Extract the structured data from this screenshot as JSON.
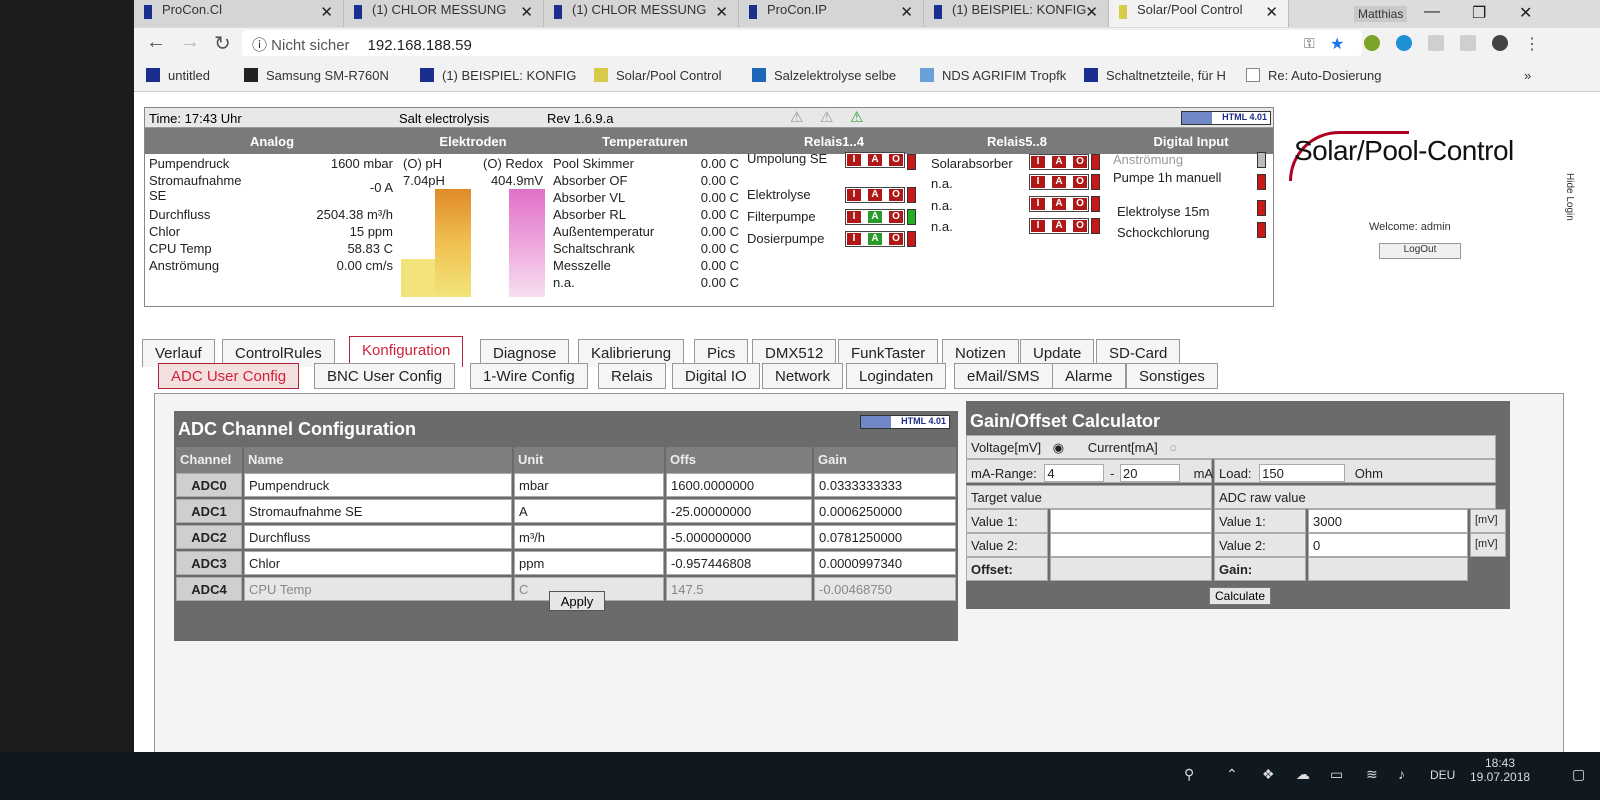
{
  "browser": {
    "tabs": [
      {
        "title": "ProCon.Cl",
        "fav": "blue"
      },
      {
        "title": "(1) CHLOR MESSUNG",
        "fav": "blue"
      },
      {
        "title": "(1) CHLOR MESSUNG",
        "fav": "blue"
      },
      {
        "title": "ProCon.IP",
        "fav": "blue"
      },
      {
        "title": "(1) BEISPIEL: KONFIG",
        "fav": "blue"
      },
      {
        "title": "Solar/Pool Control",
        "fav": "sun"
      }
    ],
    "user": "Matthias",
    "security": "Nicht sicher",
    "url": "192.168.188.59",
    "bookmarks": [
      "untitled",
      "Samsung SM-R760N",
      "(1) BEISPIEL: KONFIG",
      "Solar/Pool Control",
      "Salzelektrolyse selbe",
      "NDS AGRIFIM Tropfk",
      "Schaltnetzteile, für H",
      "Re: Auto-Dosierung"
    ]
  },
  "header": {
    "time": "Time: 17:43 Uhr",
    "mode": "Salt electrolysis",
    "rev": "Rev 1.6.9.a",
    "badge": "HTML 4.01",
    "sections": [
      "Analog",
      "Elektroden",
      "Temperaturen",
      "Relais1..4",
      "Relais5..8",
      "Digital Input"
    ],
    "analog": [
      {
        "label": "Pumpendruck",
        "value": "1600 mbar"
      },
      {
        "label": "Stromaufnahme SE",
        "value": "-0 A"
      },
      {
        "label": "Durchfluss",
        "value": "2504.38 m³/h"
      },
      {
        "label": "Chlor",
        "value": "15 ppm"
      },
      {
        "label": "CPU Temp",
        "value": "58.83 C"
      },
      {
        "label": "Anströmung",
        "value": "0.00 cm/s"
      }
    ],
    "electrodes": {
      "ph_label": "(O) pH",
      "ph_value": "7.04pH",
      "redox_label": "(O) Redox",
      "redox_value": "404.9mV"
    },
    "temps": [
      {
        "label": "Pool Skimmer",
        "value": "0.00 C"
      },
      {
        "label": "Absorber OF",
        "value": "0.00 C"
      },
      {
        "label": "Absorber VL",
        "value": "0.00 C"
      },
      {
        "label": "Absorber RL",
        "value": "0.00 C"
      },
      {
        "label": "Außentemperatur",
        "value": "0.00 C"
      },
      {
        "label": "Schaltschrank",
        "value": "0.00 C"
      },
      {
        "label": "Messzelle",
        "value": "0.00 C"
      },
      {
        "label": "n.a.",
        "value": "0.00 C"
      }
    ],
    "relais1": [
      "Umpolung SE",
      "Elektrolyse",
      "Filterpumpe",
      "Dosierpumpe"
    ],
    "relais2": [
      "Solarabsorber",
      "n.a.",
      "n.a.",
      "n.a."
    ],
    "digital": [
      "Anströmung",
      "Pumpe 1h manuell",
      "Elektrolyse 15m",
      "Schockchlorung"
    ],
    "iao": {
      "i": "I",
      "a": "A",
      "o": "O"
    }
  },
  "brand": {
    "logo": "Solar/Pool-Control",
    "welcome": "Welcome:  admin",
    "logout": "LogOut",
    "hide": "Hide Login"
  },
  "tabs_main": [
    "Verlauf",
    "ControlRules",
    "Konfiguration",
    "Diagnose",
    "Kalibrierung",
    "Pics",
    "DMX512",
    "FunkTaster",
    "Notizen",
    "Update",
    "SD-Card"
  ],
  "tabs_sub": [
    "ADC User Config",
    "BNC User Config",
    "1-Wire Config",
    "Relais",
    "Digital IO",
    "Network",
    "Logindaten",
    "eMail/SMS",
    "Alarme",
    "Sonstiges"
  ],
  "adc": {
    "title": "ADC Channel Configuration",
    "cols": [
      "Channel",
      "Name",
      "Unit",
      "Offs",
      "Gain"
    ],
    "rows": [
      {
        "ch": "ADC0",
        "name": "Pumpendruck",
        "unit": "mbar",
        "offs": "1600.0000000",
        "gain": "0.0333333333"
      },
      {
        "ch": "ADC1",
        "name": "Stromaufnahme SE",
        "unit": "A",
        "offs": "-25.00000000",
        "gain": "0.0006250000"
      },
      {
        "ch": "ADC2",
        "name": "Durchfluss",
        "unit": "m³/h",
        "offs": "-5.000000000",
        "gain": "0.0781250000"
      },
      {
        "ch": "ADC3",
        "name": "Chlor",
        "unit": "ppm",
        "offs": "-0.957446808",
        "gain": "0.0000997340"
      },
      {
        "ch": "ADC4",
        "name": "CPU Temp",
        "unit": "C",
        "offs": "147.5",
        "gain": "-0.00468750"
      }
    ],
    "apply": "Apply"
  },
  "gain": {
    "title": "Gain/Offset Calculator",
    "voltage": "Voltage[mV]",
    "current": "Current[mA]",
    "range_label": "mA-Range:",
    "range_from": "4",
    "range_sep": "-",
    "range_to": "20",
    "range_unit": "mA",
    "load_label": "Load:",
    "load": "150",
    "load_unit": "Ohm",
    "target": "Target value",
    "raw": "ADC raw value",
    "v1": "Value 1:",
    "v2": "Value 2:",
    "offset": "Offset:",
    "gain": "Gain:",
    "raw1": "3000",
    "raw2": "0",
    "mv": "[mV]",
    "calculate": "Calculate"
  },
  "taskbar": {
    "lang": "DEU",
    "time": "18:43",
    "date": "19.07.2018"
  }
}
